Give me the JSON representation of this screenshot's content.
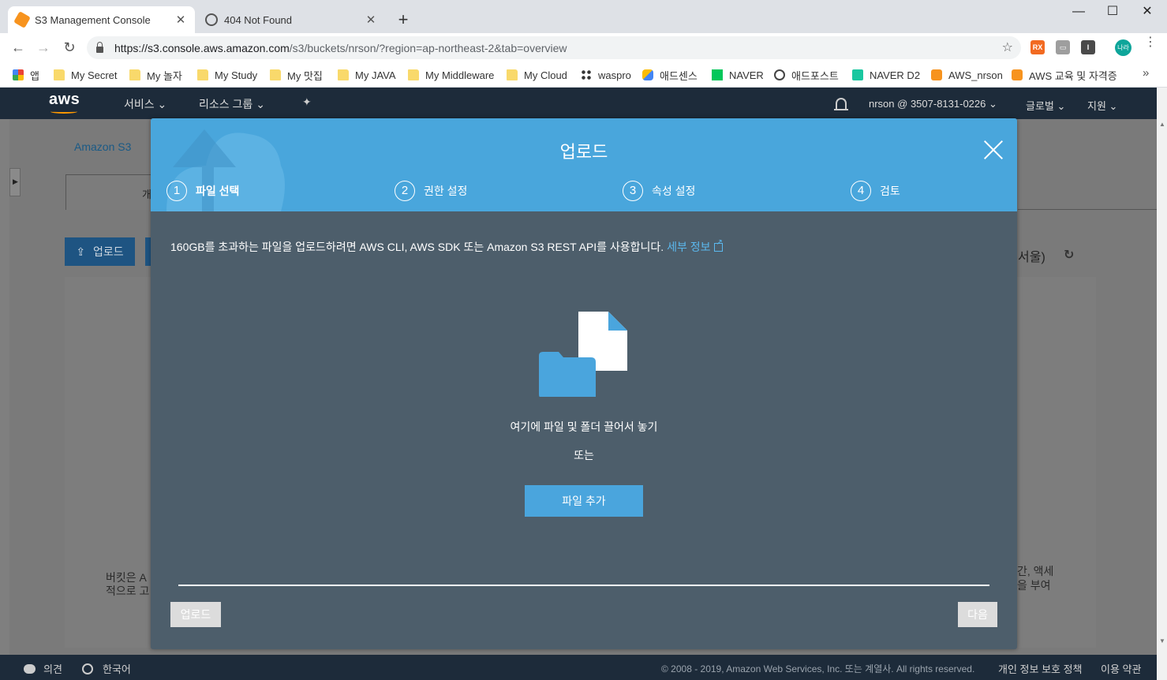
{
  "browser": {
    "tabs": [
      {
        "title": "S3 Management Console",
        "close": "✕"
      },
      {
        "title": "404 Not Found",
        "close": "✕"
      }
    ],
    "new_tab": "+",
    "window": {
      "minimize": "—",
      "maximize": "☐",
      "close": "✕"
    },
    "nav": {
      "back": "←",
      "forward": "→",
      "reload": "↻"
    },
    "url": {
      "host": "https://s3.console.aws.amazon.com",
      "path": "/s3/buckets/nrson/?region=ap-northeast-2&tab=overview"
    },
    "star": "☆",
    "extensions": [
      {
        "icon": "rss-extension-icon",
        "label": "RX",
        "color": "#f26a21"
      },
      {
        "icon": "media-extension-icon",
        "label": "▭",
        "color": "#9e9e9e"
      },
      {
        "icon": "info-extension-icon",
        "label": "I",
        "color": "#4a4a4a"
      }
    ],
    "profile_label": "나라",
    "menu": "⋮",
    "bookmarks": [
      {
        "label": "앱",
        "icon": "apps-grid-icon"
      },
      {
        "label": "My Secret",
        "icon": "folder-icon"
      },
      {
        "label": "My 놀자",
        "icon": "folder-icon"
      },
      {
        "label": "My Study",
        "icon": "folder-icon"
      },
      {
        "label": "My 맛집",
        "icon": "folder-icon"
      },
      {
        "label": "My JAVA",
        "icon": "folder-icon"
      },
      {
        "label": "My Middleware",
        "icon": "folder-icon"
      },
      {
        "label": "My Cloud",
        "icon": "folder-icon"
      },
      {
        "label": "waspro",
        "icon": "waspro-icon"
      },
      {
        "label": "애드센스",
        "icon": "adsense-icon"
      },
      {
        "label": "NAVER",
        "icon": "naver-icon"
      },
      {
        "label": "애드포스트",
        "icon": "adpost-icon"
      },
      {
        "label": "NAVER D2",
        "icon": "naver-d2-icon"
      },
      {
        "label": "AWS_nrson",
        "icon": "aws-icon"
      },
      {
        "label": "AWS 교육 및 자격증",
        "icon": "aws-icon"
      }
    ],
    "bookmarks_more": "»"
  },
  "aws_nav": {
    "logo": "aws",
    "services": "서비스",
    "resource_groups": "리소스 그룹",
    "account": "nrson @ 3507-8131-0226",
    "global": "글로벌",
    "support": "지원",
    "caret": "⌄"
  },
  "s3_page": {
    "breadcrumb": "Amazon S3",
    "tab_partial": "개",
    "upload_button": "업로드",
    "region_partial": "서울)",
    "refresh": "↻",
    "desc_left": [
      "버킷은 A",
      "적으로 고"
    ],
    "desc_right": [
      "간, 액세",
      "을 부여"
    ]
  },
  "modal": {
    "title": "업로드",
    "steps": [
      {
        "num": "1",
        "label": "파일 선택"
      },
      {
        "num": "2",
        "label": "권한 설정"
      },
      {
        "num": "3",
        "label": "속성 설정"
      },
      {
        "num": "4",
        "label": "검토"
      }
    ],
    "info_text": "160GB를 초과하는 파일을 업로드하려면 AWS CLI, AWS SDK 또는 Amazon S3 REST API를 사용합니다.",
    "info_link": "세부 정보",
    "drop_text": "여기에 파일 및 폴더 끌어서 놓기",
    "or_text": "또는",
    "add_files": "파일 추가",
    "btn_upload": "업로드",
    "btn_next": "다음"
  },
  "footer": {
    "feedback": "의견",
    "language": "한국어",
    "copyright": "© 2008 - 2019, Amazon Web Services, Inc. 또는 계열사. All rights reserved.",
    "privacy": "개인 정보 보호 정책",
    "terms": "이용 약관"
  },
  "colors": {
    "modal_header": "#49a6dc",
    "modal_body": "#4d5e6b",
    "aws_nav": "#1d2b3a",
    "accent_orange": "#f90"
  }
}
